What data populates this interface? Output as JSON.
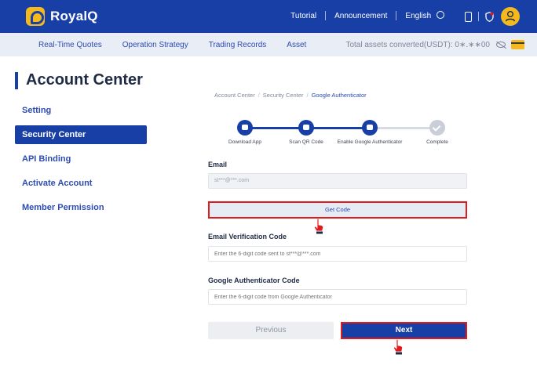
{
  "brand": {
    "name": "RoyalQ",
    "color": "#173fa6",
    "accent": "#f5b91c"
  },
  "topnav": {
    "tutorial": "Tutorial",
    "announcement": "Announcement",
    "language": "English"
  },
  "subnav": {
    "items": [
      "Real-Time Quotes",
      "Operation Strategy",
      "Trading Records",
      "Asset"
    ],
    "assets_label": "Total assets converted(USDT):",
    "assets_value": "0∗.∗∗00"
  },
  "sidebar": {
    "title": "Account Center",
    "items": [
      {
        "label": "Setting",
        "active": false
      },
      {
        "label": "Security Center",
        "active": true
      },
      {
        "label": "API Binding",
        "active": false
      },
      {
        "label": "Activate Account",
        "active": false
      },
      {
        "label": "Member Permission",
        "active": false
      }
    ]
  },
  "breadcrumb": {
    "items": [
      "Account Center",
      "Security Center",
      "Google Authenticator"
    ]
  },
  "steps": {
    "items": [
      "Download App",
      "Scan QR Code",
      "Enable Google Authenticator",
      "Complete"
    ],
    "current_step": 3
  },
  "form": {
    "email_label": "Email",
    "email_value": "st***@***.com",
    "get_code_label": "Get Code",
    "email_code_label": "Email Verification Code",
    "email_code_placeholder": "Enter the 6-digit code sent to st***@***.com",
    "ga_code_label": "Google Authenticator Code",
    "ga_code_placeholder": "Enter the 6-digit code from Google Authenticator"
  },
  "buttons": {
    "previous": "Previous",
    "next": "Next"
  },
  "colors": {
    "highlight": "#e11b1b",
    "muted": "#c9ced8"
  }
}
